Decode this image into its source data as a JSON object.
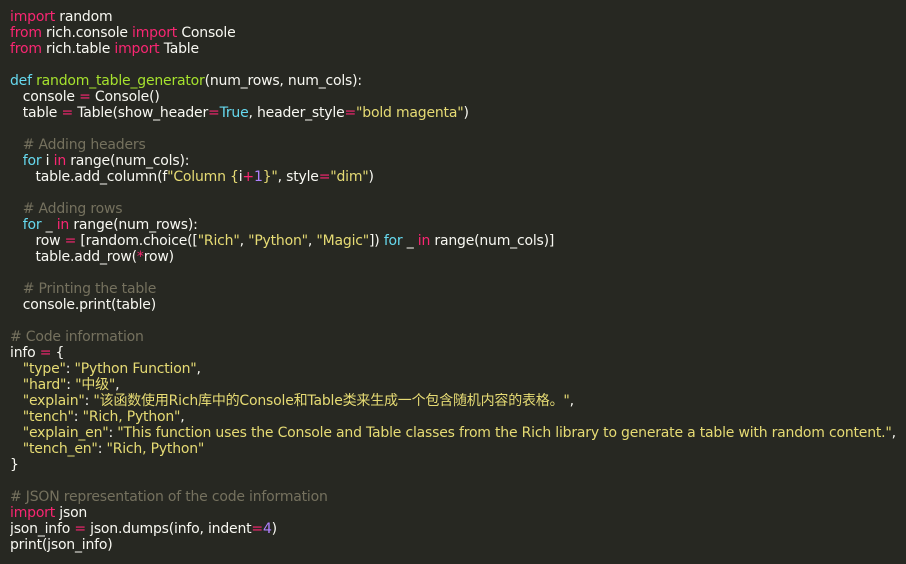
{
  "editor": {
    "background": "#272822",
    "colors": {
      "keyword": "#f92672",
      "def": "#66d9ef",
      "function": "#a6e22e",
      "builtin": "#66d9ef",
      "string": "#e6db74",
      "comment": "#75715e",
      "operator": "#f92672",
      "number": "#ae81ff",
      "plain": "#f8f8f2"
    },
    "lines": [
      [
        [
          "keyword",
          "import"
        ],
        [
          "plain",
          " random"
        ]
      ],
      [
        [
          "keyword",
          "from"
        ],
        [
          "plain",
          " rich.console "
        ],
        [
          "keyword",
          "import"
        ],
        [
          "plain",
          " Console"
        ]
      ],
      [
        [
          "keyword",
          "from"
        ],
        [
          "plain",
          " rich.table "
        ],
        [
          "keyword",
          "import"
        ],
        [
          "plain",
          " Table"
        ]
      ],
      [],
      [
        [
          "def",
          "def"
        ],
        [
          "plain",
          " "
        ],
        [
          "function",
          "random_table_generator"
        ],
        [
          "plain",
          "(num_rows, num_cols):"
        ]
      ],
      [
        [
          "plain",
          "   console "
        ],
        [
          "operator",
          "="
        ],
        [
          "plain",
          " Console()"
        ]
      ],
      [
        [
          "plain",
          "   table "
        ],
        [
          "operator",
          "="
        ],
        [
          "plain",
          " Table(show_header"
        ],
        [
          "operator",
          "="
        ],
        [
          "def",
          "True"
        ],
        [
          "plain",
          ", header_style"
        ],
        [
          "operator",
          "="
        ],
        [
          "string",
          "\"bold magenta\""
        ],
        [
          "plain",
          ")"
        ]
      ],
      [],
      [
        [
          "comment",
          "   # Adding headers"
        ]
      ],
      [
        [
          "plain",
          "   "
        ],
        [
          "def",
          "for"
        ],
        [
          "plain",
          " i "
        ],
        [
          "keyword",
          "in"
        ],
        [
          "plain",
          " range(num_cols):"
        ]
      ],
      [
        [
          "plain",
          "      table.add_column(f"
        ],
        [
          "string",
          "\"Column {"
        ],
        [
          "plain",
          "i"
        ],
        [
          "operator",
          "+"
        ],
        [
          "number",
          "1"
        ],
        [
          "string",
          "}\""
        ],
        [
          "plain",
          ", style"
        ],
        [
          "operator",
          "="
        ],
        [
          "string",
          "\"dim\""
        ],
        [
          "plain",
          ")"
        ]
      ],
      [],
      [
        [
          "comment",
          "   # Adding rows"
        ]
      ],
      [
        [
          "plain",
          "   "
        ],
        [
          "def",
          "for"
        ],
        [
          "plain",
          " _ "
        ],
        [
          "keyword",
          "in"
        ],
        [
          "plain",
          " range(num_rows):"
        ]
      ],
      [
        [
          "plain",
          "      row "
        ],
        [
          "operator",
          "="
        ],
        [
          "plain",
          " [random.choice(["
        ],
        [
          "string",
          "\"Rich\""
        ],
        [
          "plain",
          ", "
        ],
        [
          "string",
          "\"Python\""
        ],
        [
          "plain",
          ", "
        ],
        [
          "string",
          "\"Magic\""
        ],
        [
          "plain",
          "]) "
        ],
        [
          "def",
          "for"
        ],
        [
          "plain",
          " _ "
        ],
        [
          "keyword",
          "in"
        ],
        [
          "plain",
          " range(num_cols)]"
        ]
      ],
      [
        [
          "plain",
          "      table.add_row("
        ],
        [
          "operator",
          "*"
        ],
        [
          "plain",
          "row)"
        ]
      ],
      [],
      [
        [
          "comment",
          "   # Printing the table"
        ]
      ],
      [
        [
          "plain",
          "   console.print(table)"
        ]
      ],
      [],
      [
        [
          "comment",
          "# Code information"
        ]
      ],
      [
        [
          "plain",
          "info "
        ],
        [
          "operator",
          "="
        ],
        [
          "plain",
          " {"
        ]
      ],
      [
        [
          "plain",
          "   "
        ],
        [
          "string",
          "\"type\""
        ],
        [
          "plain",
          ": "
        ],
        [
          "string",
          "\"Python Function\""
        ],
        [
          "plain",
          ","
        ]
      ],
      [
        [
          "plain",
          "   "
        ],
        [
          "string",
          "\"hard\""
        ],
        [
          "plain",
          ": "
        ],
        [
          "string",
          "\"中级\""
        ],
        [
          "plain",
          ","
        ]
      ],
      [
        [
          "plain",
          "   "
        ],
        [
          "string",
          "\"explain\""
        ],
        [
          "plain",
          ": "
        ],
        [
          "string",
          "\"该函数使用Rich库中的Console和Table类来生成一个包含随机内容的表格。\""
        ],
        [
          "plain",
          ","
        ]
      ],
      [
        [
          "plain",
          "   "
        ],
        [
          "string",
          "\"tench\""
        ],
        [
          "plain",
          ": "
        ],
        [
          "string",
          "\"Rich, Python\""
        ],
        [
          "plain",
          ","
        ]
      ],
      [
        [
          "plain",
          "   "
        ],
        [
          "string",
          "\"explain_en\""
        ],
        [
          "plain",
          ": "
        ],
        [
          "string",
          "\"This function uses the Console and Table classes from the Rich library to generate a table with random content.\""
        ],
        [
          "plain",
          ","
        ]
      ],
      [
        [
          "plain",
          "   "
        ],
        [
          "string",
          "\"tench_en\""
        ],
        [
          "plain",
          ": "
        ],
        [
          "string",
          "\"Rich, Python\""
        ]
      ],
      [
        [
          "plain",
          "}"
        ]
      ],
      [],
      [
        [
          "comment",
          "# JSON representation of the code information"
        ]
      ],
      [
        [
          "keyword",
          "import"
        ],
        [
          "plain",
          " json"
        ]
      ],
      [
        [
          "plain",
          "json_info "
        ],
        [
          "operator",
          "="
        ],
        [
          "plain",
          " json.dumps(info, indent"
        ],
        [
          "operator",
          "="
        ],
        [
          "number",
          "4"
        ],
        [
          "plain",
          ")"
        ]
      ],
      [
        [
          "plain",
          "print(json_info)"
        ]
      ]
    ]
  }
}
